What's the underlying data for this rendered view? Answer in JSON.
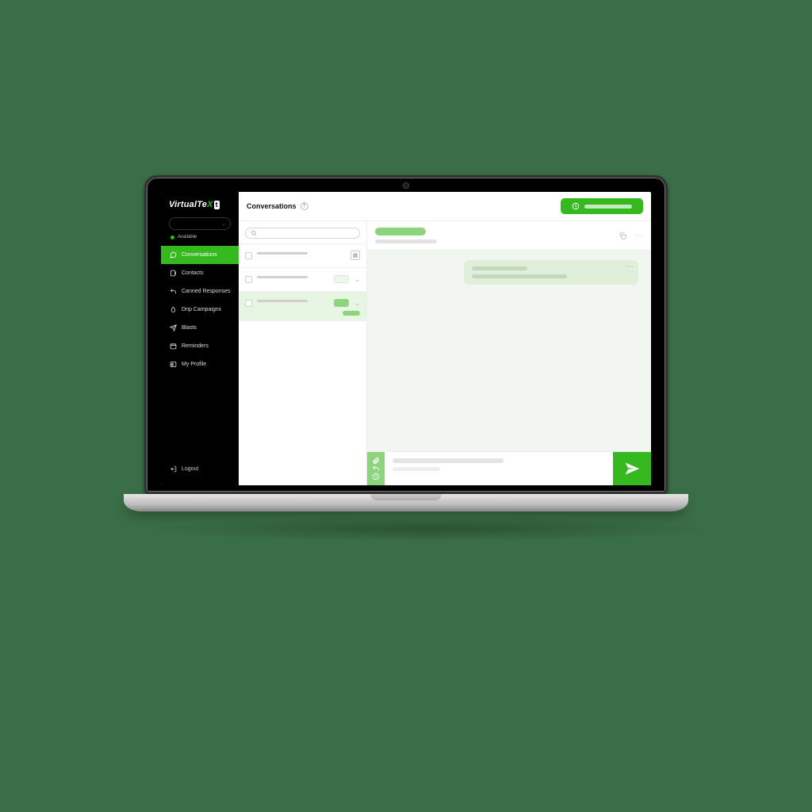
{
  "brand": {
    "part1": "Virtual",
    "part2": "Te",
    "x": "X",
    "badge": "t"
  },
  "status": {
    "label": "Available"
  },
  "sidebar": {
    "items": [
      {
        "label": "Conversations"
      },
      {
        "label": "Contacts"
      },
      {
        "label": "Canned Responses"
      },
      {
        "label": "Drip Campaigns"
      },
      {
        "label": "Blasts"
      },
      {
        "label": "Reminders"
      },
      {
        "label": "My Profile"
      }
    ],
    "logout": "Logout"
  },
  "page": {
    "title": "Conversations",
    "help": "?"
  }
}
